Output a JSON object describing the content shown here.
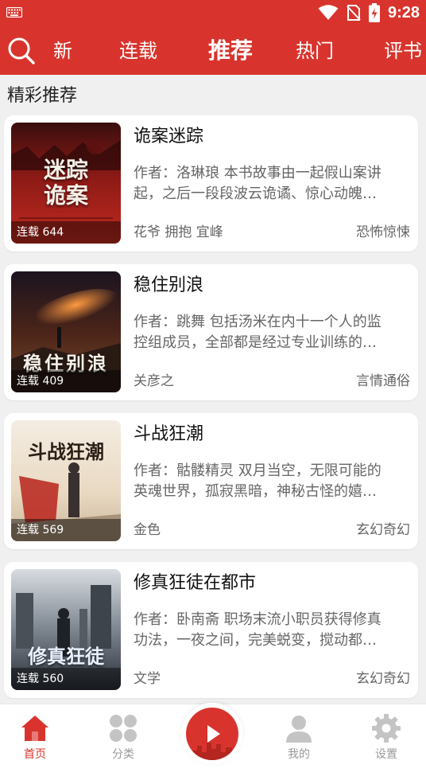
{
  "status_bar": {
    "time": "9:28"
  },
  "top_nav": {
    "tabs": [
      {
        "label": "最新",
        "visible": "新"
      },
      {
        "label": "连载"
      },
      {
        "label": "推荐",
        "active": true
      },
      {
        "label": "热门"
      },
      {
        "label": "评书"
      }
    ]
  },
  "section": {
    "title": "精彩推荐"
  },
  "books": [
    {
      "title": "诡案迷踪",
      "cover_title": "迷踪\n诡案",
      "badge": "连载 644",
      "desc_line1": "作者：洛琳琅 本书故事由一起假山案讲",
      "desc_line2": "起，之后一段段波云诡谲、惊心动魄…",
      "tags": "花爷 拥抱 宜峰",
      "genre": "恐怖惊悚"
    },
    {
      "title": "稳住别浪",
      "cover_title": "稳住别浪",
      "badge": "连载 409",
      "desc_line1": "作者：跳舞 包括汤米在内十一个人的监",
      "desc_line2": "控组成员，全部都是经过专业训练的…",
      "tags": "关彦之",
      "genre": "言情通俗"
    },
    {
      "title": "斗战狂潮",
      "cover_title": "斗战狂潮",
      "badge": "连载 569",
      "desc_line1": "作者：骷髅精灵 双月当空，无限可能的",
      "desc_line2": "英魂世界，孤寂黑暗，神秘古怪的嬉…",
      "tags": "金色",
      "genre": "玄幻奇幻"
    },
    {
      "title": "修真狂徒在都市",
      "cover_title": "修真狂徒",
      "badge": "连载 560",
      "desc_line1": "作者：卧南斋 职场末流小职员获得修真",
      "desc_line2": "功法，一夜之间，完美蜕变，搅动都…",
      "tags": "文学",
      "genre": "玄幻奇幻"
    }
  ],
  "bottom_nav": {
    "items": [
      {
        "label": "首页",
        "icon": "home-icon",
        "active": true
      },
      {
        "label": "分类",
        "icon": "grid-icon"
      },
      {
        "label": "我的",
        "icon": "person-icon"
      },
      {
        "label": "设置",
        "icon": "gear-icon"
      }
    ],
    "center_icon": "play-icon"
  },
  "colors": {
    "accent": "#d8342d",
    "muted": "#999999"
  }
}
